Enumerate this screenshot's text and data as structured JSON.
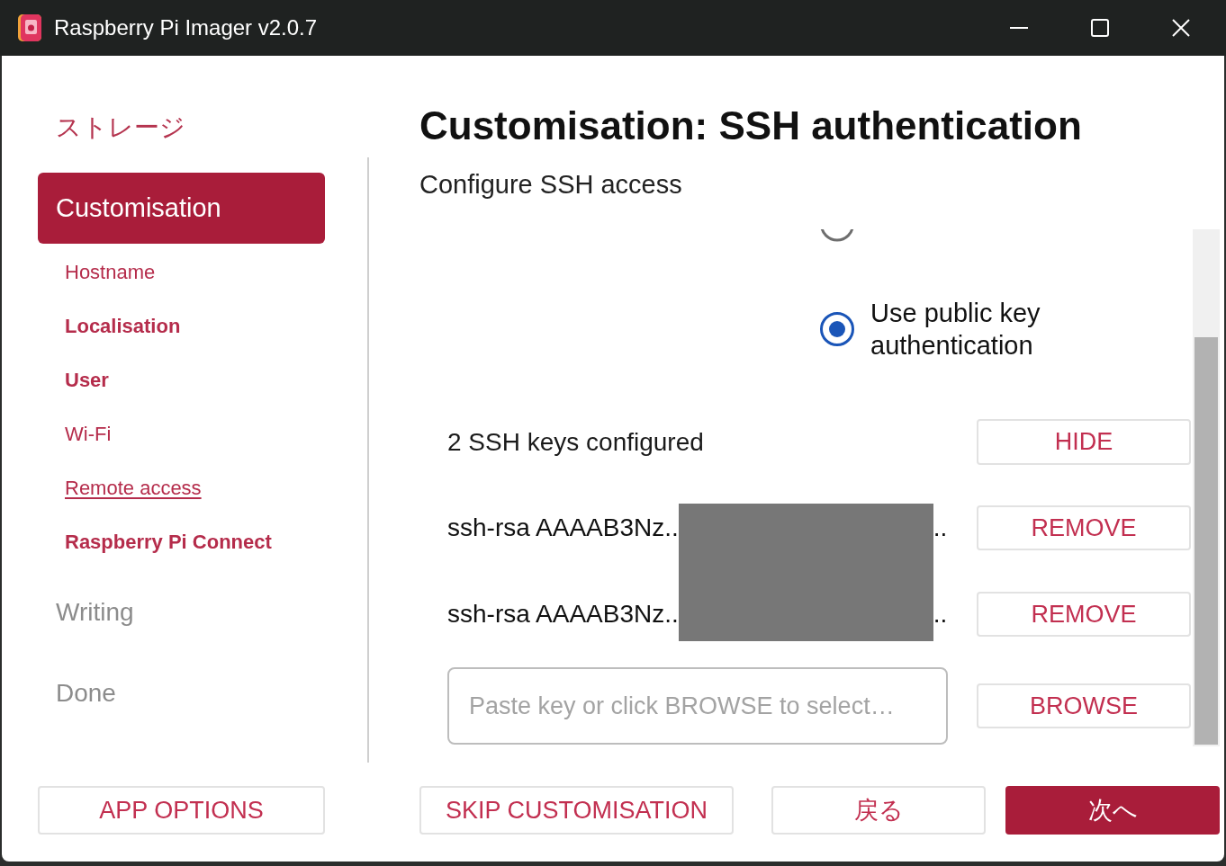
{
  "window": {
    "title": "Raspberry Pi Imager v2.0.7"
  },
  "sidebar": {
    "steps": [
      {
        "label": "ストレージ",
        "selected": false,
        "disabled": false
      },
      {
        "label": "Customisation",
        "selected": true,
        "disabled": false,
        "children": [
          {
            "label": "Hostname",
            "configured": false,
            "selected": false
          },
          {
            "label": "Localisation",
            "configured": true,
            "selected": false
          },
          {
            "label": "User",
            "configured": true,
            "selected": false
          },
          {
            "label": "Wi-Fi",
            "configured": false,
            "selected": false
          },
          {
            "label": "Remote access",
            "configured": false,
            "selected": true
          },
          {
            "label": "Raspberry Pi Connect",
            "configured": true,
            "selected": false
          }
        ]
      },
      {
        "label": "Writing",
        "selected": false,
        "disabled": true
      },
      {
        "label": "Done",
        "selected": false,
        "disabled": true
      }
    ],
    "app_options_button": "APP OPTIONS"
  },
  "page": {
    "title": "Customisation: SSH authentication",
    "subtitle": "Configure SSH access",
    "auth_options": [
      {
        "selected": false
      },
      {
        "label": "Use public key authentication",
        "selected": true
      }
    ],
    "keys_summary": "2 SSH keys configured",
    "hide_button": "HIDE",
    "keys": [
      {
        "prefix": "ssh-rsa AAAAB3Nz..",
        "suffix": "..",
        "redacted": true,
        "remove_button": "REMOVE"
      },
      {
        "prefix": "ssh-rsa AAAAB3Nz..",
        "suffix": "..",
        "redacted": true,
        "remove_button": "REMOVE"
      }
    ],
    "key_input": {
      "placeholder": "Paste key or click BROWSE to select…",
      "browse_button": "BROWSE"
    }
  },
  "footer_buttons": [
    {
      "label": "SKIP CUSTOMISATION",
      "kind": "secondary"
    },
    {
      "label": "戻る",
      "kind": "secondary"
    },
    {
      "label": "次へ",
      "kind": "primary"
    }
  ]
}
